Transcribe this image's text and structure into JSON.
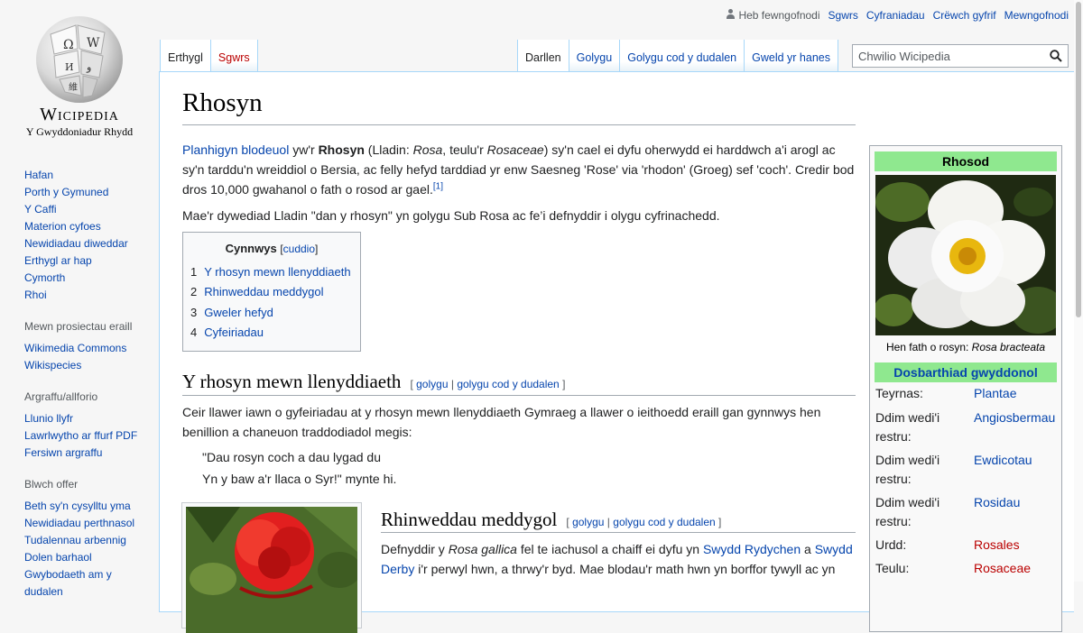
{
  "logo": {
    "wordmark": "Wicipedia",
    "tagline": "Y Gwyddoniadur Rhydd"
  },
  "personal": {
    "not_logged_in": "Heb fewngofnodi",
    "links": [
      "Sgwrs",
      "Cyfraniadau",
      "Crëwch gyfrif",
      "Mewngofnodi"
    ]
  },
  "sidebar": {
    "nav": [
      "Hafan",
      "Porth y Gymuned",
      "Y Caffi",
      "Materion cyfoes",
      "Newidiadau diweddar",
      "Erthygl ar hap",
      "Cymorth",
      "Rhoi"
    ],
    "projects_heading": "Mewn prosiectau eraill",
    "projects": [
      "Wikimedia Commons",
      "Wikispecies"
    ],
    "print_heading": "Argraffu/allforio",
    "print": [
      "Llunio llyfr",
      "Lawrlwytho ar ffurf PDF",
      "Fersiwn argraffu"
    ],
    "tools_heading": "Blwch offer",
    "tools": [
      "Beth sy'n cysylltu yma",
      "Newidiadau perthnasol",
      "Tudalennau arbennig",
      "Dolen barhaol",
      "Gwybodaeth am y dudalen"
    ]
  },
  "tabs": {
    "left": [
      "Erthygl",
      "Sgwrs"
    ],
    "right": [
      "Darllen",
      "Golygu",
      "Golygu cod y dudalen",
      "Gweld yr hanes"
    ]
  },
  "search": {
    "placeholder": "Chwilio Wicipedia"
  },
  "article": {
    "title": "Rhosyn",
    "intro": {
      "link1": "Planhigyn blodeuol",
      "t1": " yw'r ",
      "bold": "Rhosyn",
      "t2": " (Lladin: ",
      "it1": "Rosa",
      "t3": ", teulu'r ",
      "it2": "Rosaceae",
      "t4": ") sy'n cael ei dyfu oherwydd ei harddwch a'i arogl ac sy'n tarddu'n wreiddiol o Bersia, ac felly hefyd tarddiad yr enw Saesneg 'Rose' via 'rhodon' (Groeg) sef 'coch'. Credir bod dros 10,000 gwahanol o fath o rosod ar gael.",
      "ref": "[1]"
    },
    "para2": "Mae'r dywediad Lladin \"dan y rhosyn\" yn golygu Sub Rosa ac fe’i defnyddir i olygu cyfrinachedd.",
    "toc": {
      "title": "Cynnwys",
      "hide": "cuddio",
      "items": [
        {
          "num": "1",
          "label": "Y rhosyn mewn llenyddiaeth"
        },
        {
          "num": "2",
          "label": "Rhinweddau meddygol"
        },
        {
          "num": "3",
          "label": "Gweler hefyd"
        },
        {
          "num": "4",
          "label": "Cyfeiriadau"
        }
      ]
    },
    "edit": {
      "open": "[",
      "edit": "golygu",
      "sep": "|",
      "source": "golygu cod y dudalen",
      "close": "]"
    },
    "section1": {
      "heading": "Y rhosyn mewn llenyddiaeth",
      "text": "Ceir llawer iawn o gyfeiriadau at y rhosyn mewn llenyddiaeth Gymraeg a llawer o ieithoedd eraill gan gynnwys hen benillion a chaneuon traddodiadol megis:",
      "quote1": "\"Dau rosyn coch a dau lygad du",
      "quote2": "Yn y baw a'r llaca o Syr!\" mynte hi."
    },
    "section2": {
      "heading": "Rhinweddau meddygol",
      "t1": "Defnyddir y ",
      "it": "Rosa gallica",
      "t2": " fel te iachusol a chaiff ei dyfu yn ",
      "link1": "Swydd Rydychen",
      "t3": " a ",
      "link2": "Swydd Derby",
      "t4": " i'r perwyl hwn, a thrwy'r byd. Mae blodau'r math hwn yn borffor tywyll ac yn"
    }
  },
  "infobox": {
    "header": "Rhosod",
    "caption_text": "Hen fath o rosyn: ",
    "caption_italic": "Rosa bracteata",
    "classification": "Dosbarthiad gwyddonol",
    "rows": [
      {
        "key": "Teyrnas:",
        "value": "Plantae"
      },
      {
        "key": "Ddim wedi'i restru:",
        "value": "Angiosbermau"
      },
      {
        "key": "Ddim wedi'i restru:",
        "value": "Ewdicotau"
      },
      {
        "key": "Ddim wedi'i restru:",
        "value": "Rosidau"
      },
      {
        "key": "Urdd:",
        "value": "Rosales"
      },
      {
        "key": "Teulu:",
        "value": "Rosaceae"
      }
    ]
  },
  "colors": {
    "link": "#0645ad",
    "redlink": "#ba0000",
    "infobox_header": "#8fe88f",
    "tab_border": "#a7d7f9"
  }
}
